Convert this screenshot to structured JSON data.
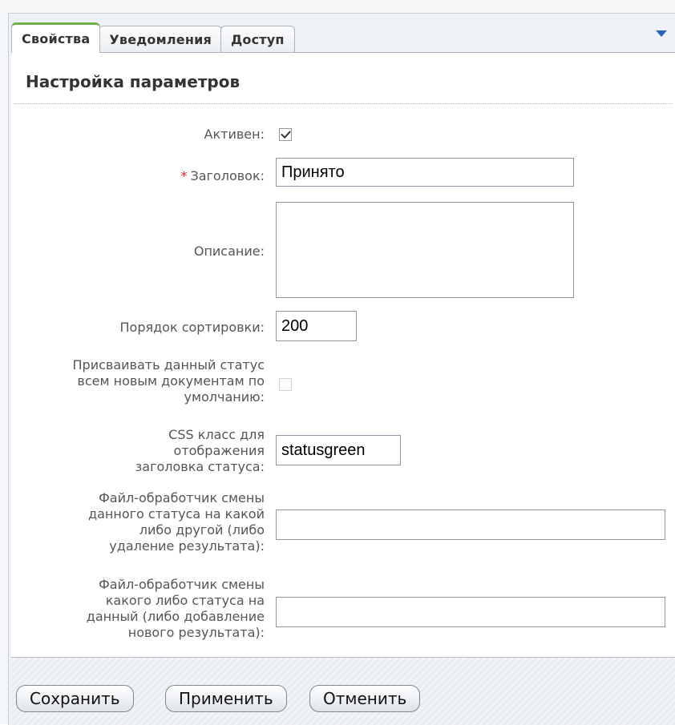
{
  "tabs": [
    {
      "label": "Свойства"
    },
    {
      "label": "Уведомления"
    },
    {
      "label": "Доступ"
    }
  ],
  "section_title": "Настройка параметров",
  "form": {
    "active_label": "Активен:",
    "active_checked": true,
    "title_required_mark": "*",
    "title_label": "Заголовок:",
    "title_value": "Принято",
    "description_label": "Описание:",
    "description_value": "",
    "sort_label": "Порядок сортировки:",
    "sort_value": "200",
    "default_label_1": "Присваивать данный статус",
    "default_label_2": "всем новым документам по",
    "default_label_3": "умолчанию:",
    "default_checked": false,
    "css_label_1": "CSS класс для",
    "css_label_2": "отображения",
    "css_label_3": "заголовка статуса:",
    "css_value": "statusgreen",
    "handler_out_label_1": "Файл-обработчик смены",
    "handler_out_label_2": "данного статуса на какой",
    "handler_out_label_3": "либо другой (либо",
    "handler_out_label_4": "удаление результата):",
    "handler_out_value": "",
    "handler_in_label_1": "Файл-обработчик смены",
    "handler_in_label_2": "какого либо статуса на",
    "handler_in_label_3": "данный (либо добавление",
    "handler_in_label_4": "нового результата):",
    "handler_in_value": ""
  },
  "buttons": {
    "save": "Сохранить",
    "apply": "Применить",
    "cancel": "Отменить"
  },
  "colors": {
    "active_tab_accent": "#6fb14a",
    "required_star": "#e02020",
    "dropdown_arrow": "#2a63b8"
  },
  "icons": {
    "tabs_menu": "triangle-down-icon"
  }
}
